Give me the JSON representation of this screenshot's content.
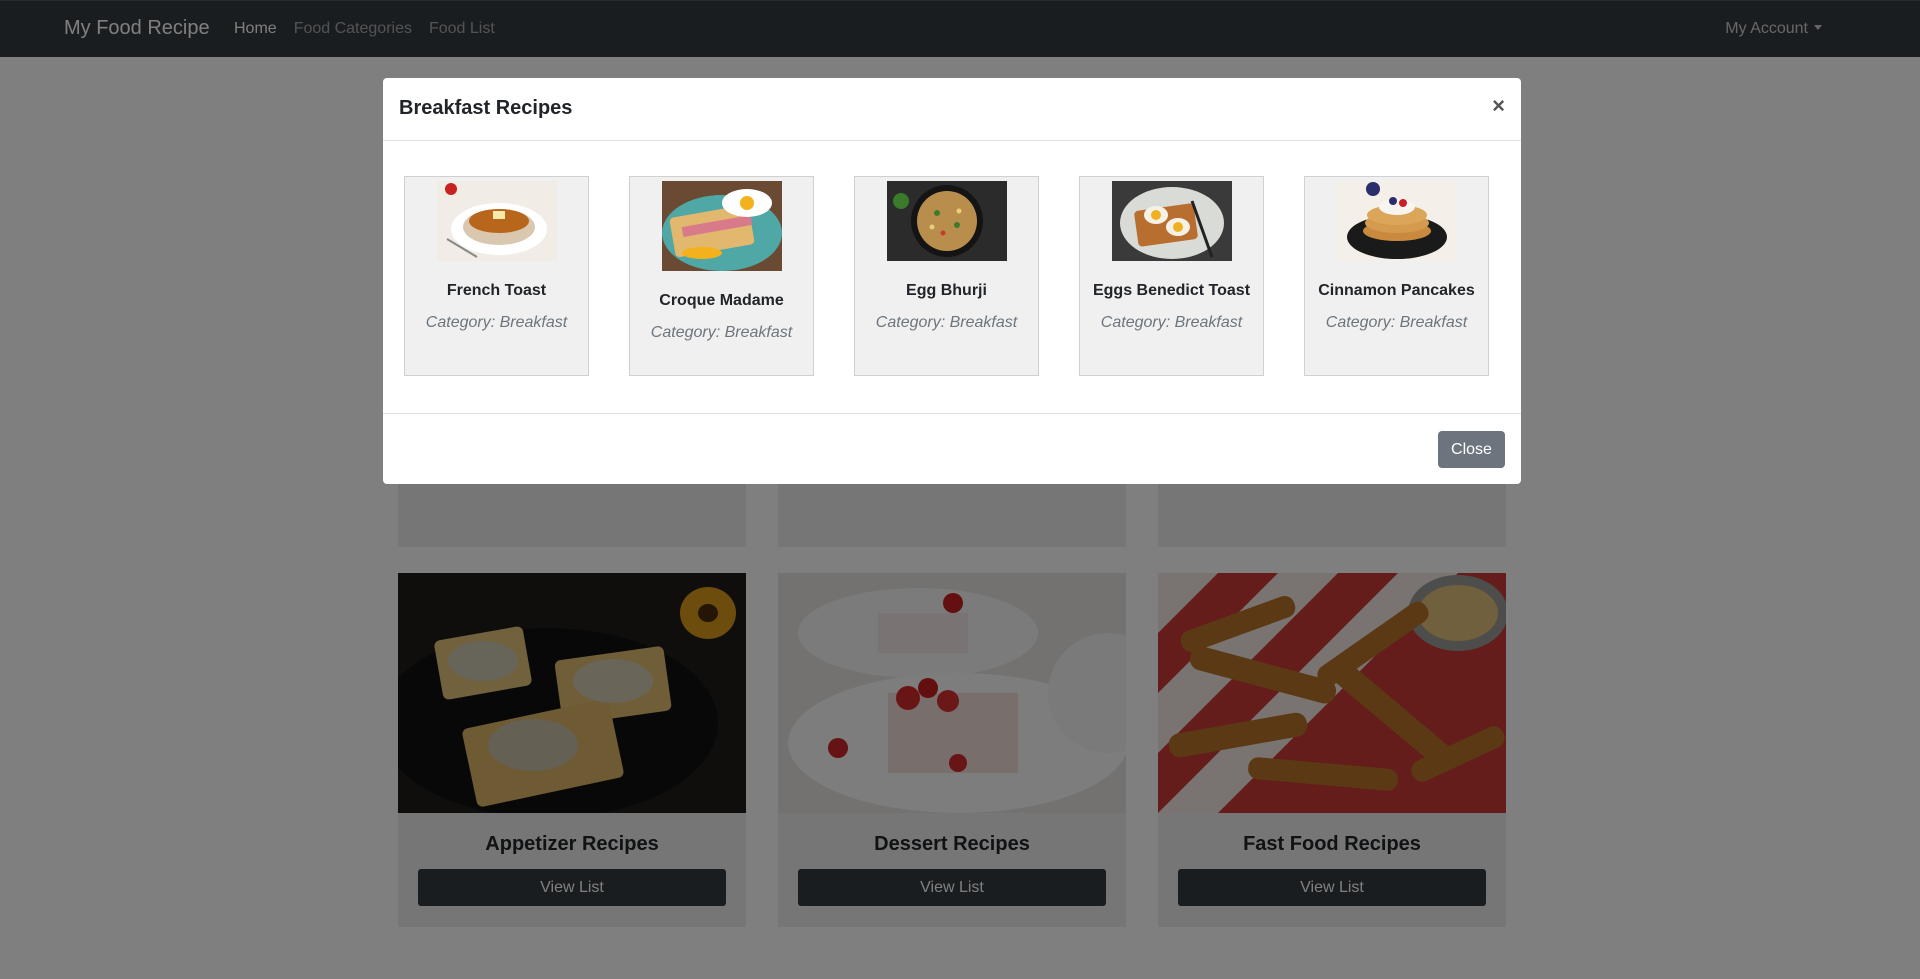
{
  "navbar": {
    "brand": "My Food Recipe",
    "links": [
      "Home",
      "Food Categories",
      "Food List"
    ],
    "account": "My Account"
  },
  "categories": [
    {
      "title": "Appetizer Recipes",
      "button": "View List"
    },
    {
      "title": "Dessert Recipes",
      "button": "View List"
    },
    {
      "title": "Fast Food Recipes",
      "button": "View List"
    }
  ],
  "modal": {
    "title": "Breakfast Recipes",
    "close_icon": "×",
    "close_button": "Close",
    "recipes": [
      {
        "name": "French Toast",
        "category": "Category: Breakfast"
      },
      {
        "name": "Croque Madame",
        "category": "Category: Breakfast"
      },
      {
        "name": "Egg Bhurji",
        "category": "Category: Breakfast"
      },
      {
        "name": "Eggs Benedict Toast",
        "category": "Category: Breakfast"
      },
      {
        "name": "Cinnamon Pancakes",
        "category": "Category: Breakfast"
      }
    ]
  }
}
